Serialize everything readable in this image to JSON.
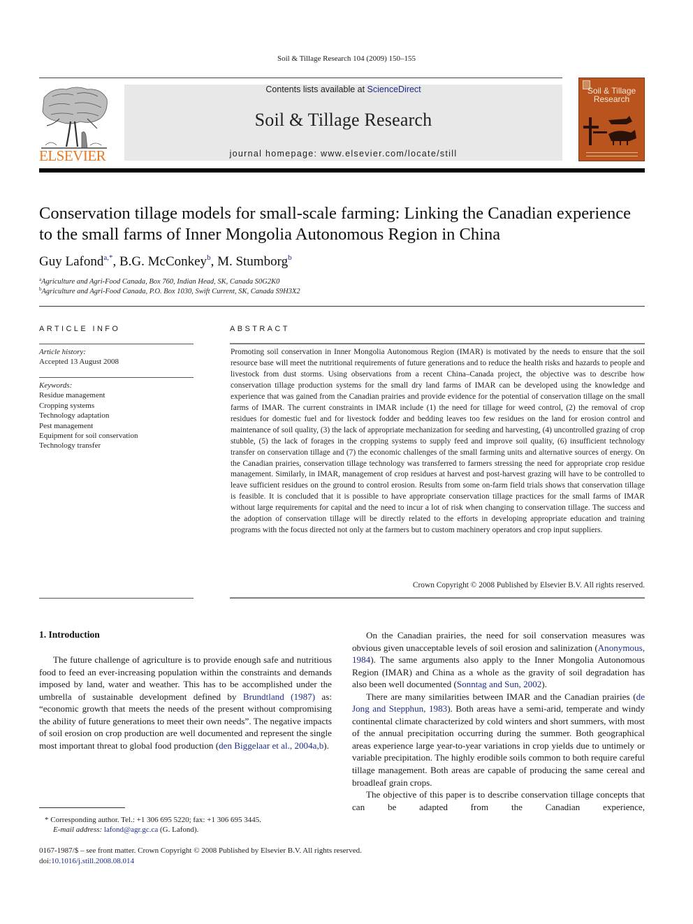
{
  "running_head": "Soil & Tillage Research 104 (2009) 150–155",
  "masthead": {
    "publisher_logo_icon": "elsevier-tree-logo",
    "publisher_name": "ELSEVIER",
    "contents_prefix": "Contents lists available at ",
    "contents_link": "ScienceDirect",
    "journal_title": "Soil & Tillage Research",
    "homepage": "journal homepage: www.elsevier.com/locate/still",
    "cover_title_line1": "Soil & Tillage",
    "cover_title_line2": "Research"
  },
  "article": {
    "title": "Conservation tillage models for small-scale farming: Linking the Canadian experience to the small farms of Inner Mongolia Autonomous Region in China",
    "authors": [
      {
        "name": "Guy Lafond",
        "sup": "a,*",
        "sep": ", "
      },
      {
        "name": "B.G. McConkey",
        "sup": "b",
        "sep": ", "
      },
      {
        "name": "M. Stumborg",
        "sup": "b",
        "sep": ""
      }
    ],
    "affiliations": [
      {
        "mark": "a",
        "text": "Agriculture and Agri-Food Canada, Box 760, Indian Head, SK, Canada S0G2K0"
      },
      {
        "mark": "b",
        "text": "Agriculture and Agri-Food Canada, P.O. Box 1030, Swift Current, SK, Canada S9H3X2"
      }
    ]
  },
  "article_info": {
    "heading": "ARTICLE INFO",
    "history_label": "Article history:",
    "history_value": "Accepted 13 August 2008",
    "keywords_label": "Keywords:",
    "keywords": [
      "Residue management",
      "Cropping systems",
      "Technology adaptation",
      "Pest management",
      "Equipment for soil conservation",
      "Technology transfer"
    ]
  },
  "abstract": {
    "heading": "ABSTRACT",
    "text": "Promoting soil conservation in Inner Mongolia Autonomous Region (IMAR) is motivated by the needs to ensure that the soil resource base will meet the nutritional requirements of future generations and to reduce the health risks and hazards to people and livestock from dust storms. Using observations from a recent China–Canada project, the objective was to describe how conservation tillage production systems for the small dry land farms of IMAR can be developed using the knowledge and experience that was gained from the Canadian prairies and provide evidence for the potential of conservation tillage on the small farms of IMAR. The current constraints in IMAR include (1) the need for tillage for weed control, (2) the removal of crop residues for domestic fuel and for livestock fodder and bedding leaves too few residues on the land for erosion control and maintenance of soil quality, (3) the lack of appropriate mechanization for seeding and harvesting, (4) uncontrolled grazing of crop stubble, (5) the lack of forages in the cropping systems to supply feed and improve soil quality, (6) insufficient technology transfer on conservation tillage and (7) the economic challenges of the small farming units and alternative sources of energy. On the Canadian prairies, conservation tillage technology was transferred to farmers stressing the need for appropriate crop residue management. Similarly, in IMAR, management of crop residues at harvest and post-harvest grazing will have to be controlled to leave sufficient residues on the ground to control erosion. Results from some on-farm field trials shows that conservation tillage is feasible. It is concluded that it is possible to have appropriate conservation tillage practices for the small farms of IMAR without large requirements for capital and the need to incur a lot of risk when changing to conservation tillage. The success and the adoption of conservation tillage will be directly related to the efforts in developing appropriate education and training programs with the focus directed not only at the farmers but to custom machinery operators and crop input suppliers.",
    "copyright": "Crown Copyright © 2008 Published by Elsevier B.V. All rights reserved."
  },
  "body": {
    "section_heading": "1.  Introduction",
    "left_p1_a": "The future challenge of agriculture is to provide enough safe and nutritious food to feed an ever-increasing population within the constraints and demands imposed by land, water and weather. This has to be accomplished under the umbrella of sustainable development defined by ",
    "left_p1_link1": "Brundtland (1987)",
    "left_p1_b": " as: “economic growth that meets the needs of the present without compromising the ability of future generations to meet their own needs”. The negative impacts of soil erosion on crop production are well documented and represent the single most important threat to global food production (",
    "left_p1_link2": "den Biggelaar et al., 2004a,b",
    "left_p1_c": ").",
    "right_p1_a": "On the Canadian prairies, the need for soil conservation measures was obvious given unacceptable levels of soil erosion and salinization (",
    "right_p1_link1": "Anonymous, 1984",
    "right_p1_b": "). The same arguments also apply to the Inner Mongolia Autonomous Region (IMAR) and China as a whole as the gravity of soil degradation has also been well documented (",
    "right_p1_link2": "Sonntag and Sun, 2002",
    "right_p1_c": ").",
    "right_p2_a": "There are many similarities between IMAR and the Canadian prairies (",
    "right_p2_link1": "de Jong and Stepphun, 1983",
    "right_p2_b": "). Both areas have a semi-arid, temperate and windy continental climate characterized by cold winters and short summers, with most of the annual precipitation occurring during the summer. Both geographical areas experience large year-to-year variations in crop yields due to untimely or variable precipitation. The highly erodible soils common to both require careful tillage management. Both areas are capable of producing the same cereal and broadleaf grain crops.",
    "right_p3": "The objective of this paper is to describe conservation tillage concepts that can be adapted from the Canadian experience,"
  },
  "footnotes": {
    "corresponding": "*  Corresponding author. Tel.: +1 306 695 5220; fax: +1 306 695 3445.",
    "email_label": "E-mail address: ",
    "email": "lafond@agr.gc.ca",
    "email_suffix": " (G. Lafond).",
    "front_matter": "0167-1987/$ – see front matter. Crown Copyright © 2008 Published by Elsevier B.V. All rights reserved.",
    "doi_prefix": "doi:",
    "doi": "10.1016/j.still.2008.08.014"
  },
  "colors": {
    "link": "#1f2d8a",
    "elsevier_orange": "#e87722",
    "masthead_gray": "#e8e8e8",
    "cover_orange": "#b9541f"
  }
}
